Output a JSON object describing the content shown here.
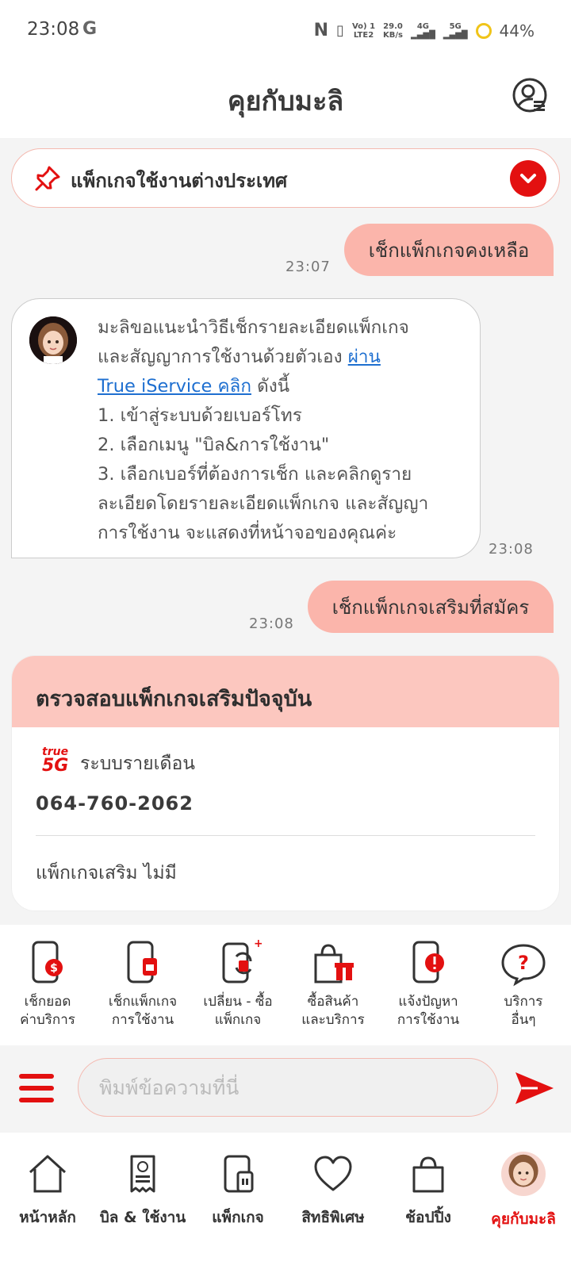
{
  "status_bar": {
    "time": "23:08",
    "carrier_g": "G",
    "nfc": "N",
    "volte": "Vo) 1\nLTE2",
    "speed": "29.0\nKB/s",
    "net1": "4G",
    "net2": "5G",
    "battery": "44%"
  },
  "header": {
    "title": "คุยกับมะลิ"
  },
  "pinned": {
    "label": "แพ็กเกจใช้งานต่างประเทศ"
  },
  "messages": {
    "user1": {
      "text": "เช็กแพ็กเกจคงเหลือ",
      "time": "23:07"
    },
    "bot1": {
      "line1": "มะลิขอแนะนำวิธีเช็กรายละเอียดแพ็กเกจ",
      "line2_prefix": "และสัญญาการใช้งานด้วยตัวเอง ",
      "link1": "ผ่าน",
      "link2": "True iService คลิก",
      "line3_suffix": " ดังนี้",
      "step1": "1. เข้าสู่ระบบด้วยเบอร์โทร",
      "step2": "2. เลือกเมนู \"บิล&การใช้งาน\"",
      "step3a": "3. เลือกเบอร์ที่ต้องการเช็ก และคลิกดูราย",
      "step3b": "ละเอียดโดยรายละเอียดแพ็กเกจ และสัญญา",
      "step3c": "การใช้งาน จะแสดงที่หน้าจอของคุณค่ะ",
      "time": "23:08"
    },
    "user2": {
      "text": "เช็กแพ็กเกจเสริมที่สมัคร",
      "time": "23:08"
    }
  },
  "addon_card": {
    "title": "ตรวจสอบแพ็กเกจเสริมปัจจุบัน",
    "logo_text_top": "true",
    "logo_text_bottom": "5G",
    "plan_type": "ระบบรายเดือน",
    "phone_number": "064-760-2062",
    "addon_status": "แพ็กเกจเสริม ไม่มี"
  },
  "quick_actions": [
    {
      "line1": "เช็กยอด",
      "line2": "ค่าบริการ",
      "icon": "phone-bill-icon"
    },
    {
      "line1": "เช็กแพ็กเกจ",
      "line2": "การใช้งาน",
      "icon": "phone-sim-icon"
    },
    {
      "line1": "เปลี่ยน - ซื้อ",
      "line2": "แพ็กเกจ",
      "icon": "phone-swap-icon"
    },
    {
      "line1": "ซื้อสินค้า",
      "line2": "และบริการ",
      "icon": "shopping-gift-icon"
    },
    {
      "line1": "แจ้งปัญหา",
      "line2": "การใช้งาน",
      "icon": "phone-alert-icon"
    },
    {
      "line1": "บริการ",
      "line2": "อื่นๆ",
      "icon": "question-bubble-icon"
    }
  ],
  "input": {
    "placeholder": "พิมพ์ข้อความที่นี่"
  },
  "bottom_nav": [
    {
      "label": "หน้าหลัก",
      "icon": "home-icon"
    },
    {
      "label": "บิล & ใช้งาน",
      "icon": "bill-icon"
    },
    {
      "label": "แพ็กเกจ",
      "icon": "package-icon"
    },
    {
      "label": "สิทธิพิเศษ",
      "icon": "heart-icon"
    },
    {
      "label": "ช้อปปิ้ง",
      "icon": "shopping-bag-icon"
    },
    {
      "label": "คุยกับมะลิ",
      "icon": "mali-avatar-icon",
      "active": true
    }
  ],
  "colors": {
    "accent": "#e31010",
    "user_bubble": "#fbb5ab",
    "card_header": "#fcc7bf"
  }
}
